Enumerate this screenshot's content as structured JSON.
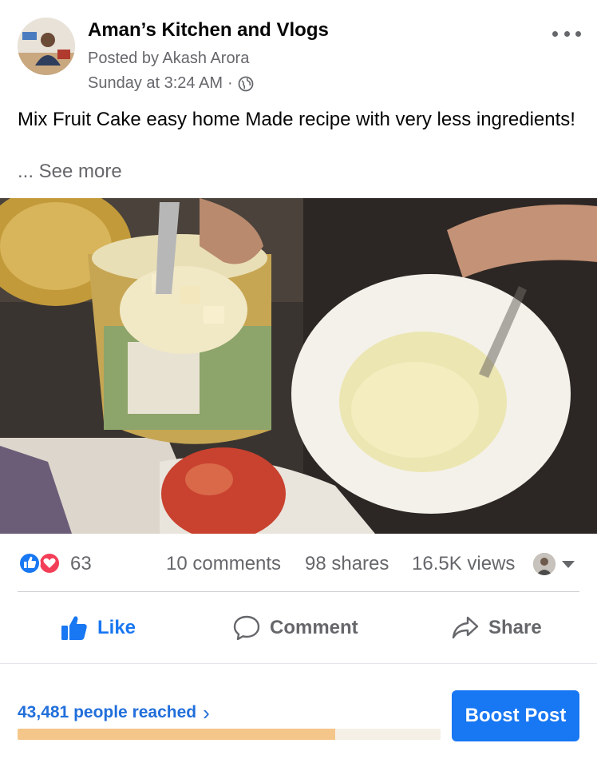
{
  "post": {
    "page_name": "Aman’s Kitchen and Vlogs",
    "posted_by": "Posted by Akash Arora",
    "time": "Sunday at 3:24 AM",
    "time_separator": "·",
    "audience_icon": "globe-icon",
    "more_icon": "more-options-icon",
    "caption": "Mix Fruit Cake easy home Made recipe with very less ingredients!",
    "see_more": "... See more"
  },
  "stats": {
    "reaction_icons": [
      "like-reaction-icon",
      "love-reaction-icon"
    ],
    "reaction_count": "63",
    "comments": "10 comments",
    "shares": "98 shares",
    "views": "16.5K views"
  },
  "actions": {
    "like": "Like",
    "comment": "Comment",
    "share": "Share"
  },
  "footer": {
    "reach": "43,481 people reached",
    "reach_chevron": "›",
    "reach_progress": 0.75,
    "boost": "Boost Post"
  },
  "colors": {
    "brand_blue": "#1877f2",
    "link_blue": "#216fdb",
    "secondary_text": "#65676b",
    "reach_bar": "#f5c68a",
    "love_red": "#f33e58"
  }
}
